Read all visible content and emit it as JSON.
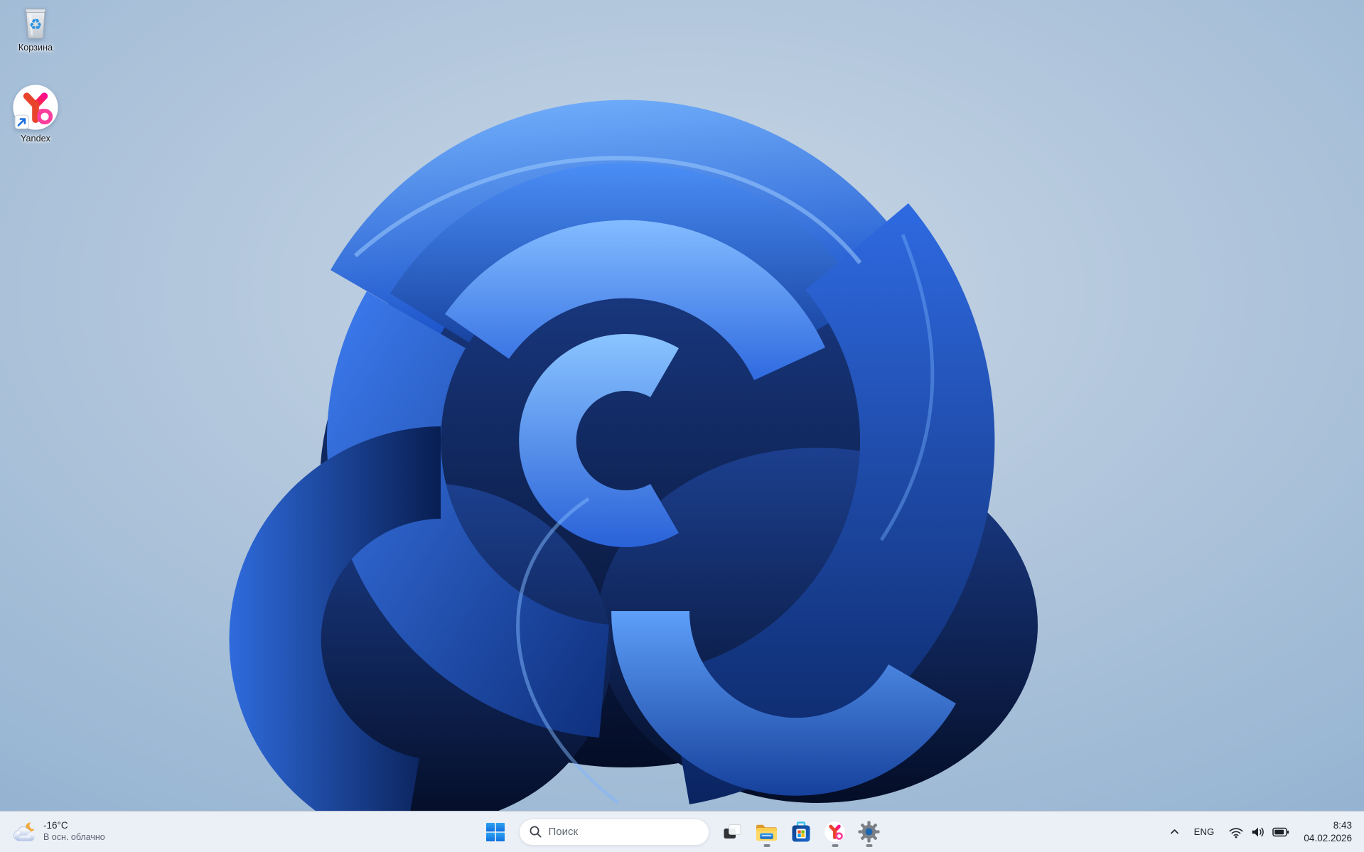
{
  "desktop": {
    "icons": [
      {
        "id": "recycle-bin",
        "label": "Корзина"
      },
      {
        "id": "yandex-shortcut",
        "label": "Yandex"
      }
    ]
  },
  "taskbar": {
    "weather": {
      "temperature": "-16°C",
      "condition": "В осн. облачно",
      "icon": "moon-cloud-icon"
    },
    "search": {
      "placeholder": "Поиск",
      "icon": "search-icon"
    },
    "apps": [
      {
        "name": "task-view",
        "icon": "task-view-icon",
        "running": false
      },
      {
        "name": "file-explorer",
        "icon": "folder-icon",
        "running": true
      },
      {
        "name": "microsoft-store",
        "icon": "store-icon",
        "running": false
      },
      {
        "name": "yandex-browser",
        "icon": "yandex-icon",
        "running": true
      },
      {
        "name": "settings",
        "icon": "gear-icon",
        "running": true
      }
    ],
    "tray": {
      "language": "ENG",
      "time": "8:43",
      "date": "04.02.2026",
      "icons": [
        "chevron-up-icon",
        "wifi-icon",
        "volume-icon",
        "battery-icon"
      ]
    }
  },
  "colors": {
    "taskbar_bg": "#f0f3f9",
    "accent_blue": "#1e7be4",
    "bloom_dark": "#081c4e",
    "bloom_bright": "#4a8ef6",
    "background_sky": "#9db9d6"
  }
}
